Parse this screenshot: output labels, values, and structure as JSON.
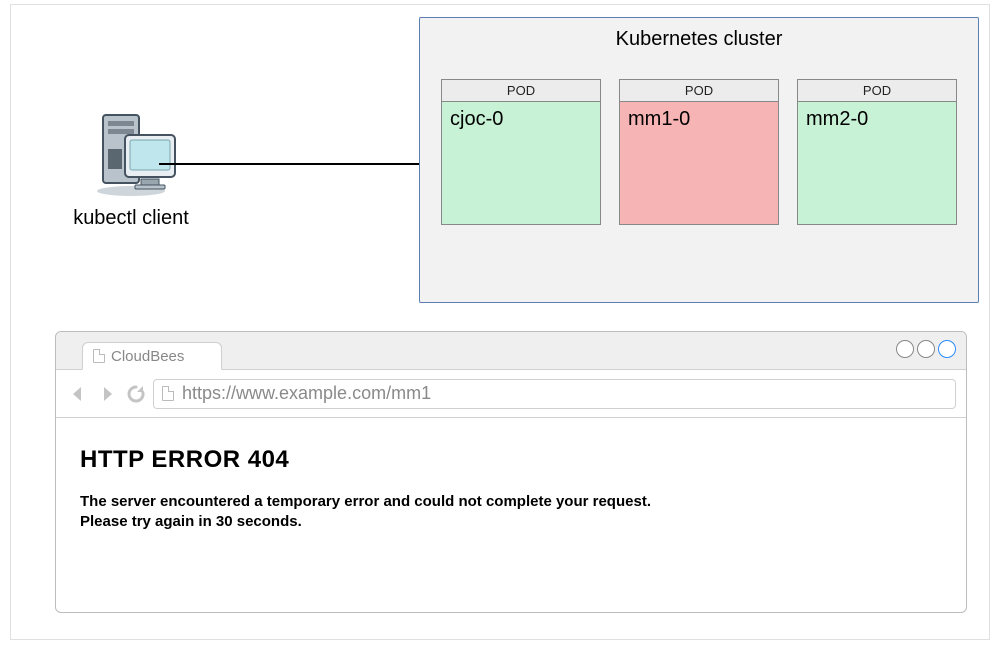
{
  "kubectl": {
    "label": "kubectl client"
  },
  "cluster": {
    "title": "Kubernetes cluster",
    "pod_header": "POD",
    "pods": [
      {
        "name": "cjoc-0",
        "status": "ok"
      },
      {
        "name": "mm1-0",
        "status": "error"
      },
      {
        "name": "mm2-0",
        "status": "ok"
      }
    ]
  },
  "browser": {
    "tab_title": "CloudBees",
    "url": "https://www.example.com/mm1",
    "error_title": "HTTP ERROR 404",
    "error_line1": "The server encountered a temporary error and could not complete your request.",
    "error_line2": "Please try again in 30 seconds."
  }
}
